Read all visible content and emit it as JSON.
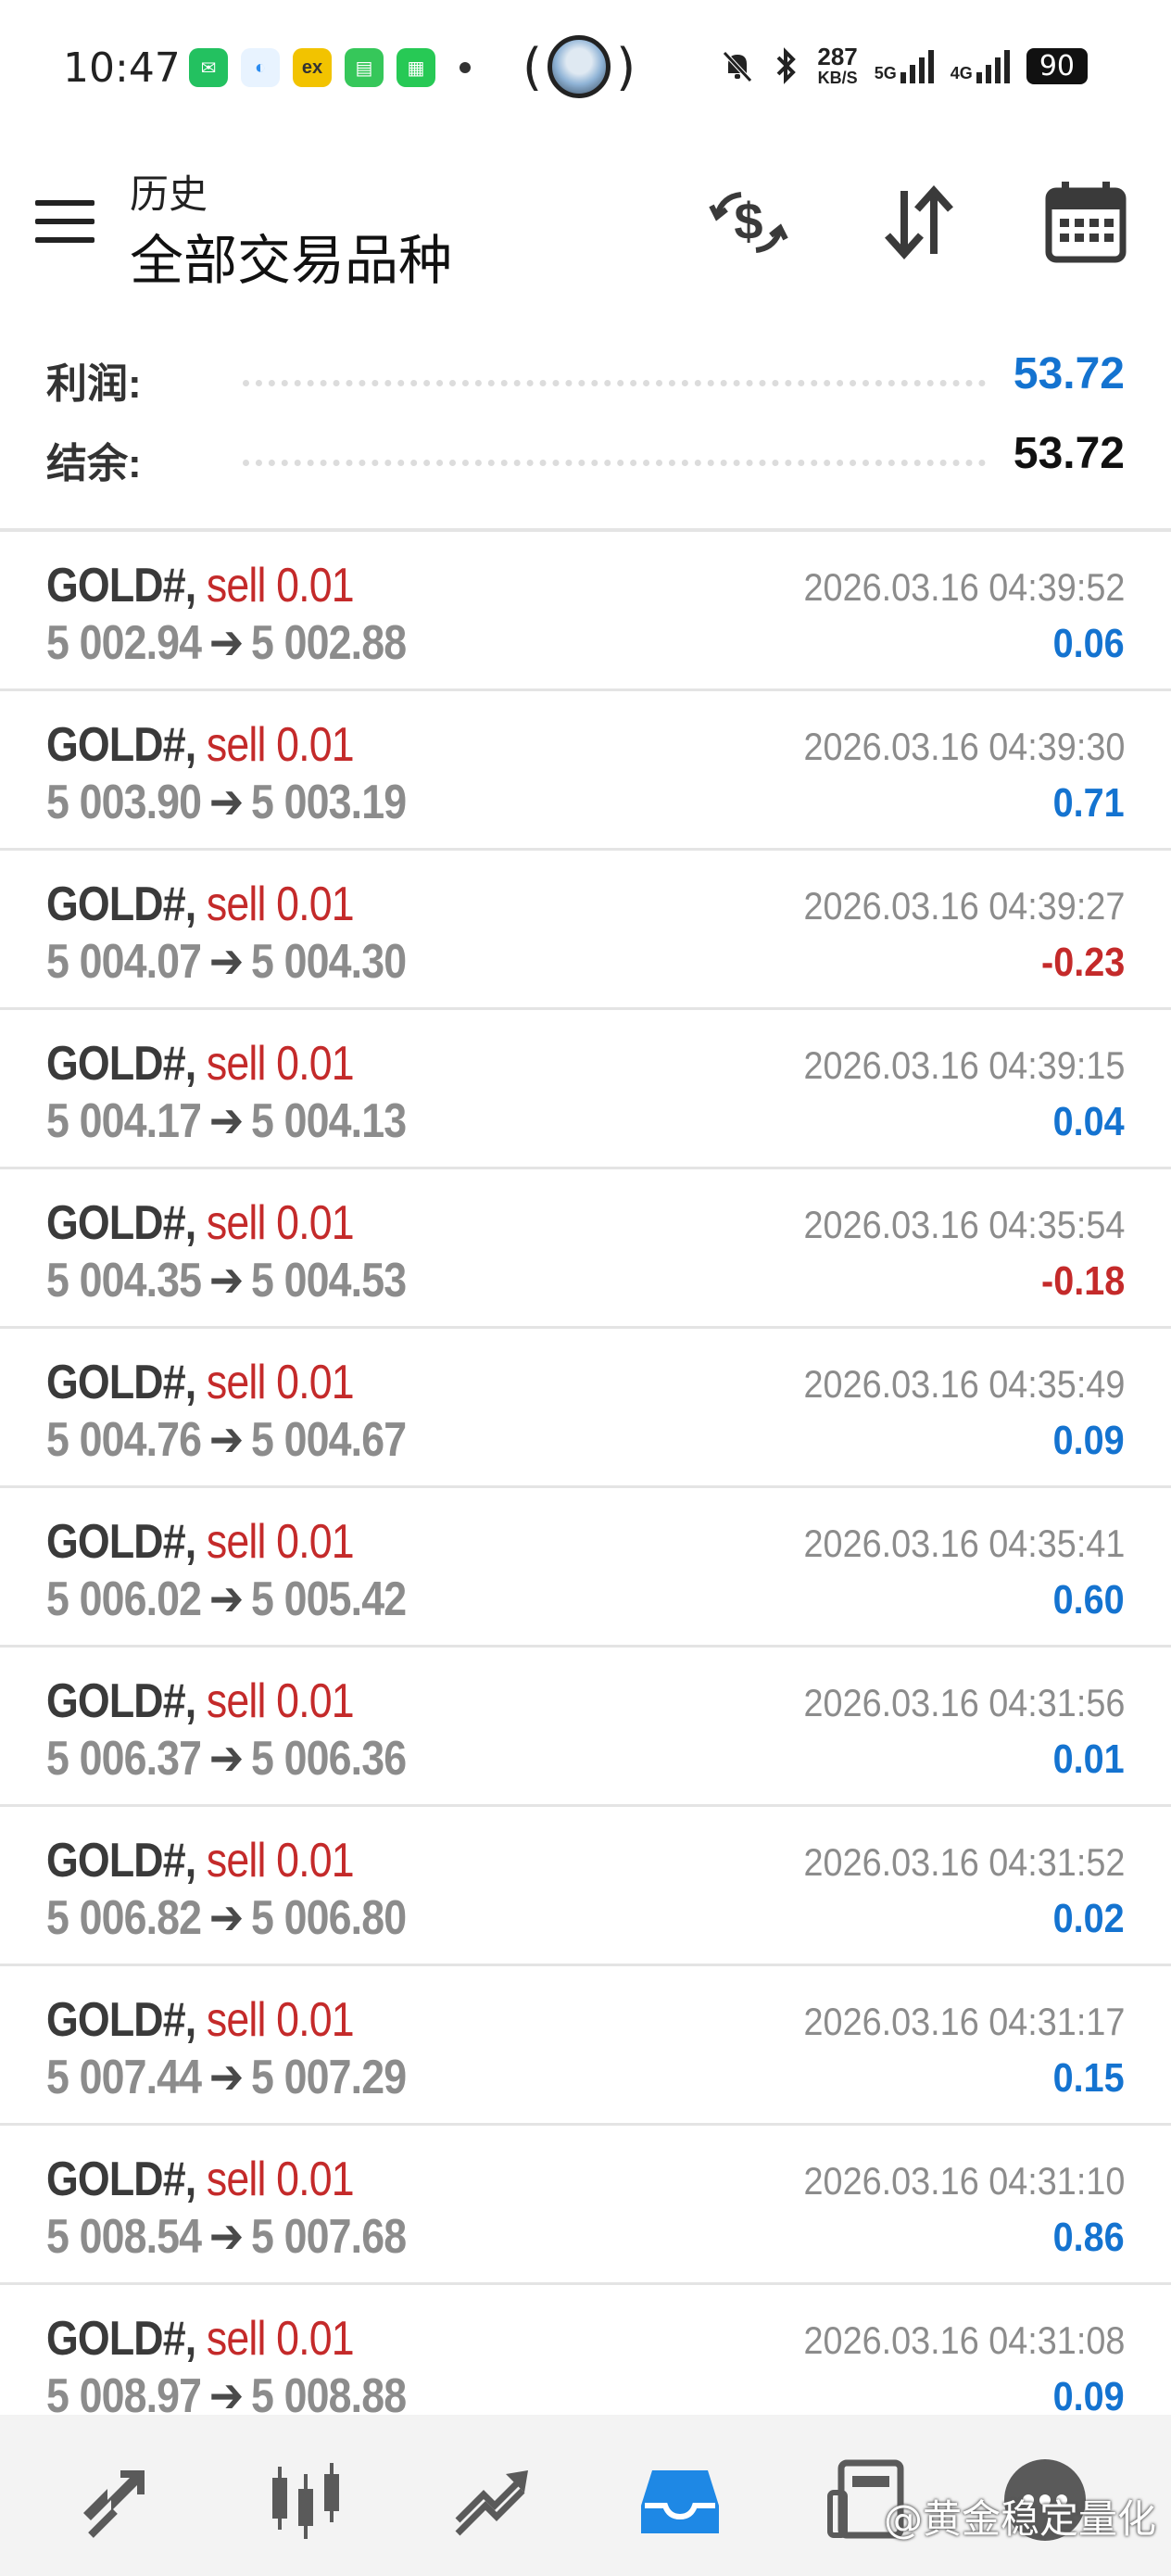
{
  "status_bar": {
    "time": "10:47",
    "apps": [
      {
        "icon": "wechat-icon",
        "color": "#23c160",
        "glyph": "✉"
      },
      {
        "icon": "browser-icon",
        "color": "#4aa3f0",
        "glyph": "◐"
      },
      {
        "icon": "ex-app-icon",
        "color": "#f2c300",
        "glyph": "ex"
      },
      {
        "icon": "notes-icon",
        "color": "#36c75a",
        "glyph": "▤"
      },
      {
        "icon": "store-icon",
        "color": "#27c955",
        "glyph": "▦"
      }
    ],
    "network_speed": "287",
    "network_unit": "KB/S",
    "signal_1": "5G",
    "signal_2": "4G",
    "battery": "90"
  },
  "header": {
    "title": "历史",
    "subtitle": "全部交易品种",
    "icons": [
      "currency-exchange-icon",
      "sort-icon",
      "calendar-icon"
    ]
  },
  "summary": {
    "profit_label": "利润:",
    "profit_value": "53.72",
    "balance_label": "结余:",
    "balance_value": "53.72"
  },
  "trades": [
    {
      "symbol": "GOLD#,",
      "side": "sell 0.01",
      "open": "5 002.94",
      "close": "5 002.88",
      "time": "2026.03.16 04:39:52",
      "profit": "0.06",
      "positive": true
    },
    {
      "symbol": "GOLD#,",
      "side": "sell 0.01",
      "open": "5 003.90",
      "close": "5 003.19",
      "time": "2026.03.16 04:39:30",
      "profit": "0.71",
      "positive": true
    },
    {
      "symbol": "GOLD#,",
      "side": "sell 0.01",
      "open": "5 004.07",
      "close": "5 004.30",
      "time": "2026.03.16 04:39:27",
      "profit": "-0.23",
      "positive": false
    },
    {
      "symbol": "GOLD#,",
      "side": "sell 0.01",
      "open": "5 004.17",
      "close": "5 004.13",
      "time": "2026.03.16 04:39:15",
      "profit": "0.04",
      "positive": true
    },
    {
      "symbol": "GOLD#,",
      "side": "sell 0.01",
      "open": "5 004.35",
      "close": "5 004.53",
      "time": "2026.03.16 04:35:54",
      "profit": "-0.18",
      "positive": false
    },
    {
      "symbol": "GOLD#,",
      "side": "sell 0.01",
      "open": "5 004.76",
      "close": "5 004.67",
      "time": "2026.03.16 04:35:49",
      "profit": "0.09",
      "positive": true
    },
    {
      "symbol": "GOLD#,",
      "side": "sell 0.01",
      "open": "5 006.02",
      "close": "5 005.42",
      "time": "2026.03.16 04:35:41",
      "profit": "0.60",
      "positive": true
    },
    {
      "symbol": "GOLD#,",
      "side": "sell 0.01",
      "open": "5 006.37",
      "close": "5 006.36",
      "time": "2026.03.16 04:31:56",
      "profit": "0.01",
      "positive": true
    },
    {
      "symbol": "GOLD#,",
      "side": "sell 0.01",
      "open": "5 006.82",
      "close": "5 006.80",
      "time": "2026.03.16 04:31:52",
      "profit": "0.02",
      "positive": true
    },
    {
      "symbol": "GOLD#,",
      "side": "sell 0.01",
      "open": "5 007.44",
      "close": "5 007.29",
      "time": "2026.03.16 04:31:17",
      "profit": "0.15",
      "positive": true
    },
    {
      "symbol": "GOLD#,",
      "side": "sell 0.01",
      "open": "5 008.54",
      "close": "5 007.68",
      "time": "2026.03.16 04:31:10",
      "profit": "0.86",
      "positive": true
    },
    {
      "symbol": "GOLD#,",
      "side": "sell 0.01",
      "open": "5 008.97",
      "close": "5 008.88",
      "time": "2026.03.16 04:31:08",
      "profit": "0.09",
      "positive": true
    }
  ],
  "bottom_nav": {
    "items": [
      "quotes-icon",
      "chart-icon",
      "trade-icon",
      "history-icon",
      "news-icon",
      "settings-icon"
    ],
    "active": "history-icon"
  },
  "watermark": "@黄金稳定量化",
  "colors": {
    "profit_positive": "#1473d0",
    "profit_negative": "#c42a2a",
    "sell": "#c42a2a",
    "active_nav": "#1e88e5"
  }
}
